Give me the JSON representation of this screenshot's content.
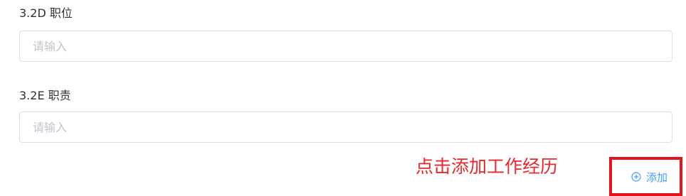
{
  "fields": [
    {
      "label": "3.2D 职位",
      "placeholder": "请输入",
      "value": ""
    },
    {
      "label": "3.2E 职责",
      "placeholder": "请输入",
      "value": ""
    }
  ],
  "annotation": {
    "text": "点击添加工作经历",
    "color": "#e8262b"
  },
  "add_button": {
    "label": "添加",
    "icon": "circle-plus-icon",
    "color": "#409eff"
  },
  "colors": {
    "label": "#303133",
    "placeholder": "#c0c4cc",
    "input_border": "#dcdfe6",
    "highlight_border": "#e3141c"
  }
}
